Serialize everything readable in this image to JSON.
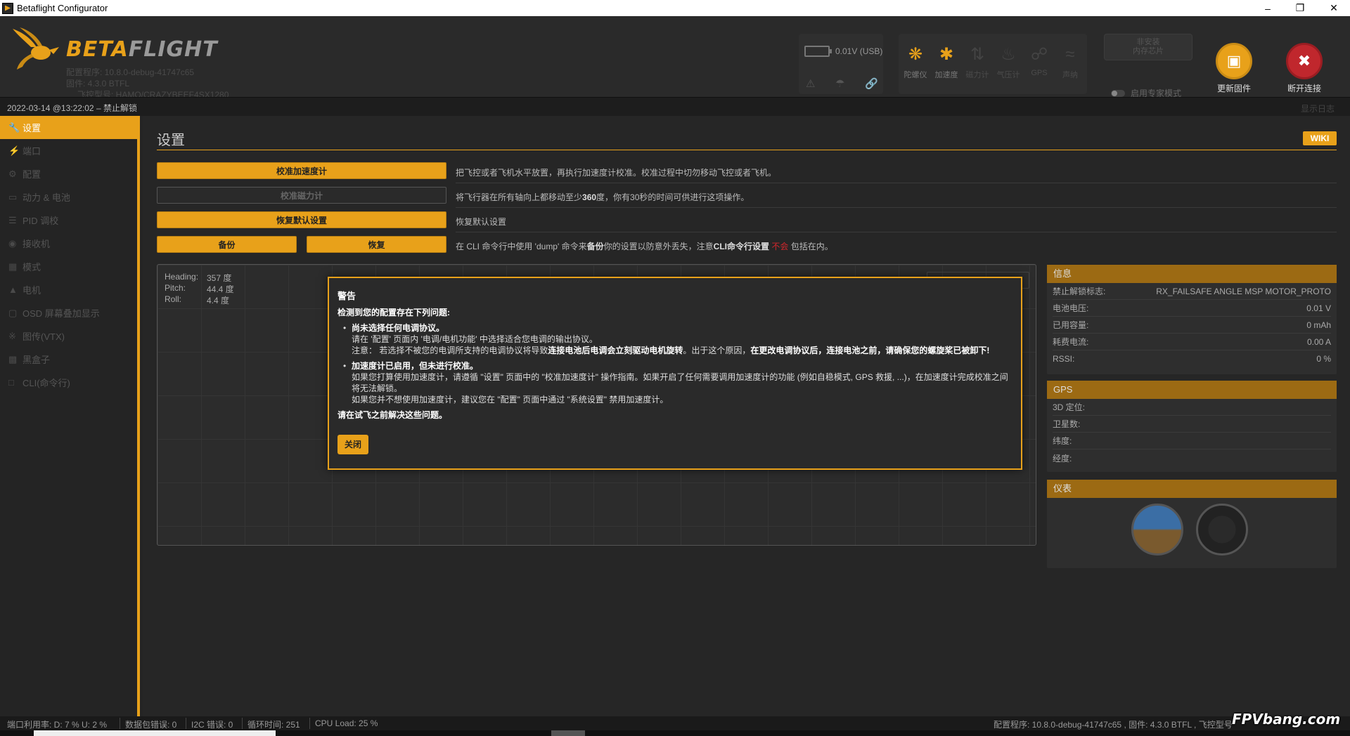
{
  "window": {
    "title": "Betaflight Configurator"
  },
  "header": {
    "brand_a": "BETA",
    "brand_b": "FLIGHT",
    "info_line1": "配置程序: 10.8.0-debug-41747c65",
    "info_line2": "固件: 4.3.0 BTFL",
    "info_line3": "飞控型号: HAMO/CRAZYBEEF4SX1280",
    "battery_text": "0.01V (USB)",
    "sensors": [
      {
        "label": "陀螺仪",
        "icon": "gyro-icon",
        "active": true
      },
      {
        "label": "加速度",
        "icon": "accel-icon",
        "active": true
      },
      {
        "label": "磁力计",
        "icon": "mag-icon",
        "active": false
      },
      {
        "label": "气压计",
        "icon": "baro-icon",
        "active": false
      },
      {
        "label": "GPS",
        "icon": "gps-icon",
        "active": false
      },
      {
        "label": "声纳",
        "icon": "sonar-icon",
        "active": false
      }
    ],
    "dfu_line1": "非安装",
    "dfu_line2": "内存芯片",
    "expert_mode": "启用专家模式",
    "flash_label": "更新固件",
    "disconnect_label": "断开连接"
  },
  "logbar": {
    "log": "2022-03-14 @13:22:02 – 禁止解锁",
    "show_log": "显示日志"
  },
  "sidebar": {
    "items": [
      {
        "label": "设置",
        "icon": "wrench-icon",
        "active": true
      },
      {
        "label": "端口",
        "icon": "plug-icon"
      },
      {
        "label": "配置",
        "icon": "gear-icon"
      },
      {
        "label": "动力 & 电池",
        "icon": "battery-icon"
      },
      {
        "label": "PID 调校",
        "icon": "sliders-icon"
      },
      {
        "label": "接收机",
        "icon": "receiver-icon"
      },
      {
        "label": "模式",
        "icon": "modes-icon"
      },
      {
        "label": "电机",
        "icon": "motor-icon"
      },
      {
        "label": "OSD 屏幕叠加显示",
        "icon": "osd-icon"
      },
      {
        "label": "图传(VTX)",
        "icon": "vtx-icon"
      },
      {
        "label": "黑盒子",
        "icon": "blackbox-icon"
      },
      {
        "label": "CLI(命令行)",
        "icon": "cli-icon"
      }
    ]
  },
  "main": {
    "title": "设置",
    "wiki": "WIKI",
    "actions": {
      "calib_acc": "校准加速度计",
      "calib_mag": "校准磁力计",
      "reset": "恢复默认设置",
      "backup": "备份",
      "restore": "恢复"
    },
    "desc": {
      "acc": "把飞控或者飞机水平放置，再执行加速度计校准。校准过程中切勿移动飞控或者飞机。",
      "mag_a": "将飞行器在所有轴向上都移动至少",
      "mag_b": "360",
      "mag_c": "度，你有30秒的时间可供进行这项操作。",
      "reset": "恢复默认设置",
      "backup_a": "在 CLI 命令行中使用 'dump' 命令来",
      "backup_b": "备份",
      "backup_c": "你的设置以防意外丢失，注意",
      "backup_d": "CLI命令行设置",
      "backup_e": "不会",
      "backup_f": "包括在内。"
    },
    "attitude": {
      "heading_label": "Heading:",
      "heading_value": "357 度",
      "pitch_label": "Pitch:",
      "pitch_value": "44.4 度",
      "roll_label": "Roll:",
      "roll_value": "4.4 度"
    },
    "info": {
      "title": "信息",
      "rows": [
        {
          "label": "禁止解锁标志:",
          "value": "RX_FAILSAFE ANGLE MSP MOTOR_PROTO"
        },
        {
          "label": "电池电压:",
          "value": "0.01 V"
        },
        {
          "label": "已用容量:",
          "value": "0 mAh"
        },
        {
          "label": "耗费电流:",
          "value": "0.00 A"
        },
        {
          "label": "RSSI:",
          "value": "0 %"
        }
      ]
    },
    "gps": {
      "title": "GPS",
      "rows": [
        {
          "label": "3D 定位:"
        },
        {
          "label": "卫星数:"
        },
        {
          "label": "纬度:"
        },
        {
          "label": "经度:"
        }
      ]
    },
    "instruments": {
      "title": "仪表"
    }
  },
  "modal": {
    "title": "警告",
    "intro": "检测到您的配置存在下列问题:",
    "issue1_title": "尚未选择任何电调协议。",
    "issue1_line1": "请在 '配置' 页面内 '电调/电机功能' 中选择适合您电调的输出协议。",
    "issue1_note_a": "注意：  若选择不被您的电调所支持的电调协议将导致",
    "issue1_note_b": "连接电池后电调会立刻驱动电机旋转",
    "issue1_note_c": "。出于这个原因，",
    "issue1_note_d": "在更改电调协议后，连接电池之前，请确保您的螺旋桨已被卸下!",
    "issue2_title": "加速度计已启用，但未进行校准。",
    "issue2_line1": "如果您打算使用加速度计，请遵循 \"设置\" 页面中的 \"校准加速度计\" 操作指南。如果开启了任何需要调用加速度计的功能 (例如自稳模式, GPS 救援, ...)，在加速度计完成校准之间将无法解锁。",
    "issue2_line2": "如果您并不想使用加速度计，建议您在 \"配置\" 页面中通过 \"系统设置\" 禁用加速度计。",
    "outro": "请在试飞之前解决这些问题。",
    "close": "关闭"
  },
  "footer": {
    "port_util": "端口利用率: D: 7 % U: 2 %",
    "packet_err": "数据包错误: 0",
    "i2c_err": "I2C 错误: 0",
    "cycle": "循环时间: 251",
    "cpu": "CPU Load: 25 %",
    "version": "配置程序: 10.8.0-debug-41747c65 , 固件: 4.3.0 BTFL , 飞控型号",
    "watermark": "FPVbang.com"
  },
  "colors": {
    "accent": "#e8a11a",
    "danger": "#c0272d",
    "background": "#242424"
  }
}
